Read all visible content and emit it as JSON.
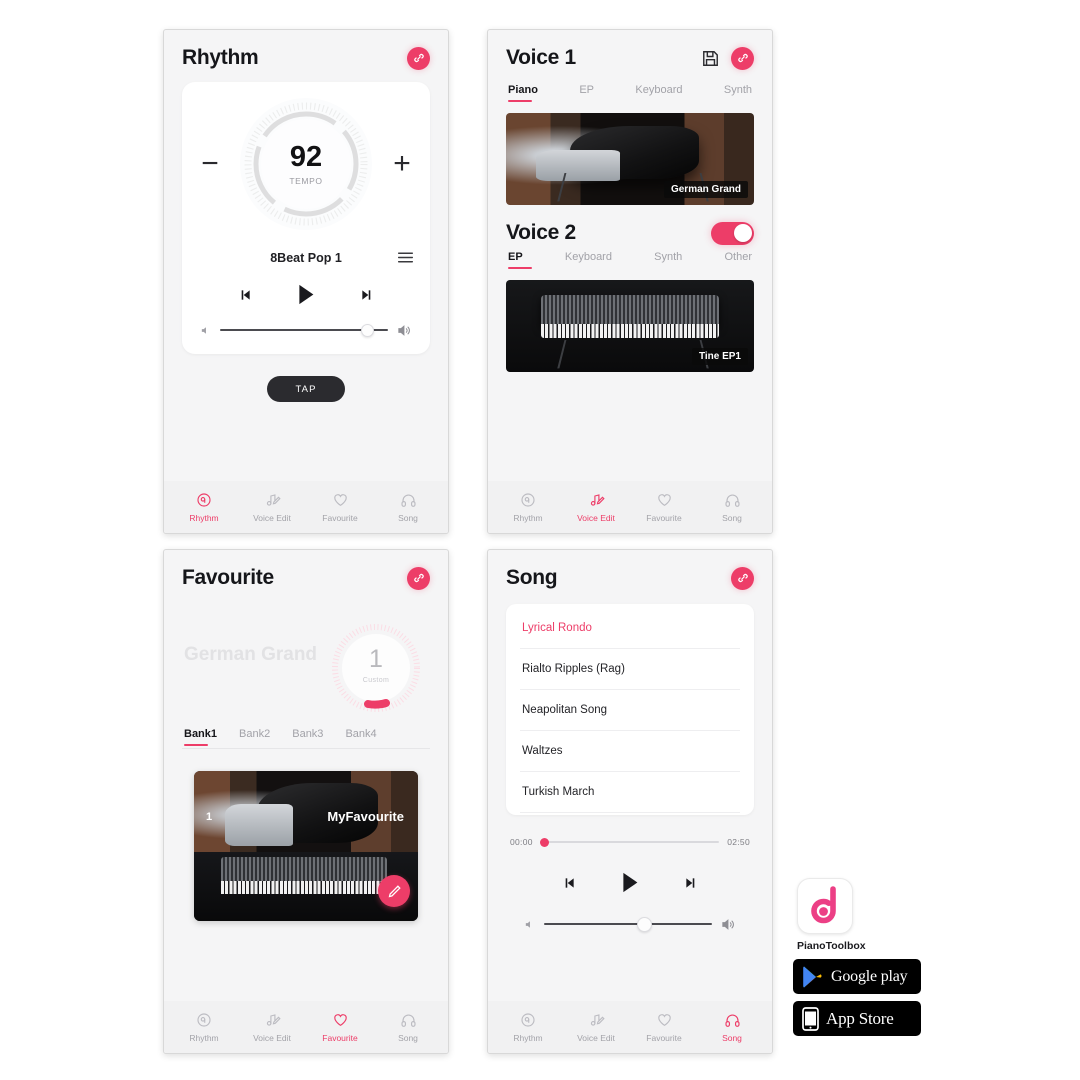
{
  "panels": {
    "rhythm": {
      "title": "Rhythm",
      "link_icon": "link-icon",
      "tempo": {
        "value": "92",
        "label": "TEMPO",
        "minus": "−",
        "plus": "+"
      },
      "pattern_name": "8Beat Pop 1",
      "list_icon": "list-icon",
      "transport": {
        "prev": "prev-icon",
        "play": "play-icon",
        "next": "next-icon"
      },
      "volume": {
        "percent": 88,
        "low_icon": "volume-low-icon",
        "high_icon": "volume-high-icon"
      },
      "tap_label": "TAP"
    },
    "voice": {
      "voice1": {
        "title": "Voice 1",
        "save_icon": "save-icon",
        "link_icon": "link-icon",
        "tabs": [
          "Piano",
          "EP",
          "Keyboard",
          "Synth"
        ],
        "active_tab": "Piano",
        "preset_name": "German Grand"
      },
      "voice2": {
        "title": "Voice 2",
        "toggle_on": true,
        "tabs": [
          "EP",
          "Keyboard",
          "Synth",
          "Other"
        ],
        "active_tab": "EP",
        "preset_name": "Tine EP1"
      }
    },
    "favourite": {
      "title": "Favourite",
      "link_icon": "link-icon",
      "voice_name": "German Grand",
      "dial": {
        "number": "1",
        "label": "Custom"
      },
      "banks": [
        "Bank1",
        "Bank2",
        "Bank3",
        "Bank4"
      ],
      "active_bank": "Bank1",
      "card": {
        "index": "1",
        "name": "MyFavourite",
        "edit_icon": "pencil-icon"
      }
    },
    "song": {
      "title": "Song",
      "link_icon": "link-icon",
      "songs": [
        "Lyrical Rondo",
        "Rialto Ripples (Rag)",
        "Neapolitan Song",
        "Waltzes",
        "Turkish March"
      ],
      "active_song": "Lyrical Rondo",
      "progress": {
        "current": "00:00",
        "total": "02:50",
        "percent": 2
      },
      "transport": {
        "prev": "prev-icon",
        "play": "play-icon",
        "next": "next-icon"
      },
      "volume": {
        "percent": 60,
        "low_icon": "volume-low-icon",
        "high_icon": "volume-high-icon"
      }
    }
  },
  "bottom_nav": {
    "items": [
      {
        "label": "Rhythm",
        "icon": "rhythm-icon"
      },
      {
        "label": "Voice Edit",
        "icon": "voice-edit-icon"
      },
      {
        "label": "Favourite",
        "icon": "heart-icon"
      },
      {
        "label": "Song",
        "icon": "headphones-icon"
      }
    ],
    "active": {
      "rhythm": "Rhythm",
      "voice": "Voice Edit",
      "favourite": "Favourite",
      "song": "Song"
    }
  },
  "store": {
    "app_name": "PianoToolbox",
    "app_icon": "pianotoolbox-logo",
    "google_play": "Google play",
    "app_store": "App Store"
  },
  "colors": {
    "accent": "#ed3d68",
    "panel_bg": "#f5f5f6",
    "nav_bg": "#f1f1f2",
    "text_dark": "#15161a",
    "text_muted": "#a3a3a9"
  }
}
